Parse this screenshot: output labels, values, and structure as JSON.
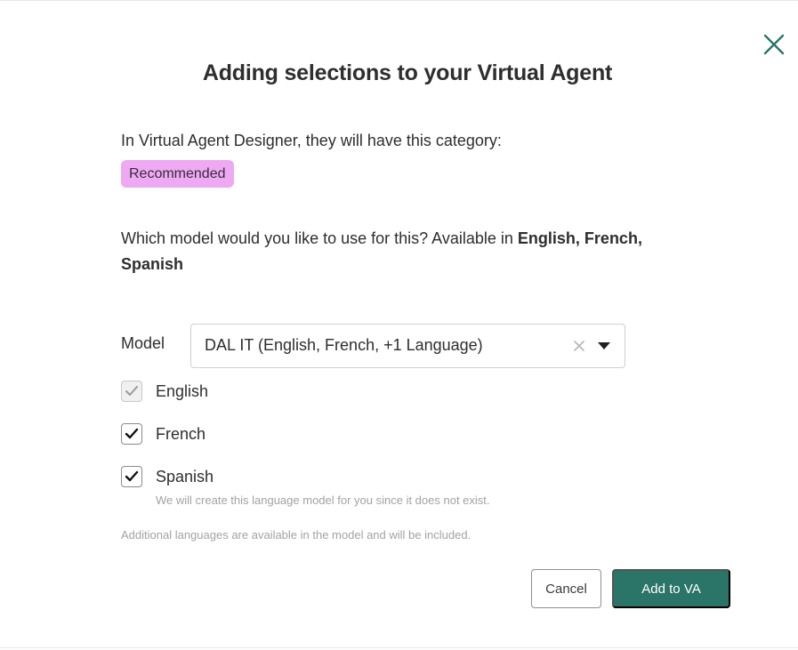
{
  "dialog": {
    "title": "Adding selections to your Virtual Agent",
    "close_icon": "close-icon",
    "category_text": "In Virtual Agent Designer, they will have this category:",
    "category_badge": "Recommended",
    "question_prefix": "Which model would you like to use for this? Available in",
    "question_languages": "English, French, Spanish"
  },
  "model": {
    "label": "Model",
    "selected": "DAL IT (English, French, +1 Language)",
    "clear_icon": "clear-icon",
    "dropdown_icon": "caret-down-icon"
  },
  "languages": [
    {
      "label": "English",
      "checked": true,
      "disabled": true
    },
    {
      "label": "French",
      "checked": true,
      "disabled": false
    },
    {
      "label": "Spanish",
      "checked": true,
      "disabled": false
    }
  ],
  "hint": "We will create this language model for you since it does not exist.",
  "note": "Additional languages are available in the model and will be included.",
  "buttons": {
    "cancel": "Cancel",
    "add": "Add to VA"
  },
  "colors": {
    "accent": "#2b7468",
    "badge_bg": "#eda9f2",
    "close_icon": "#2b7468"
  }
}
